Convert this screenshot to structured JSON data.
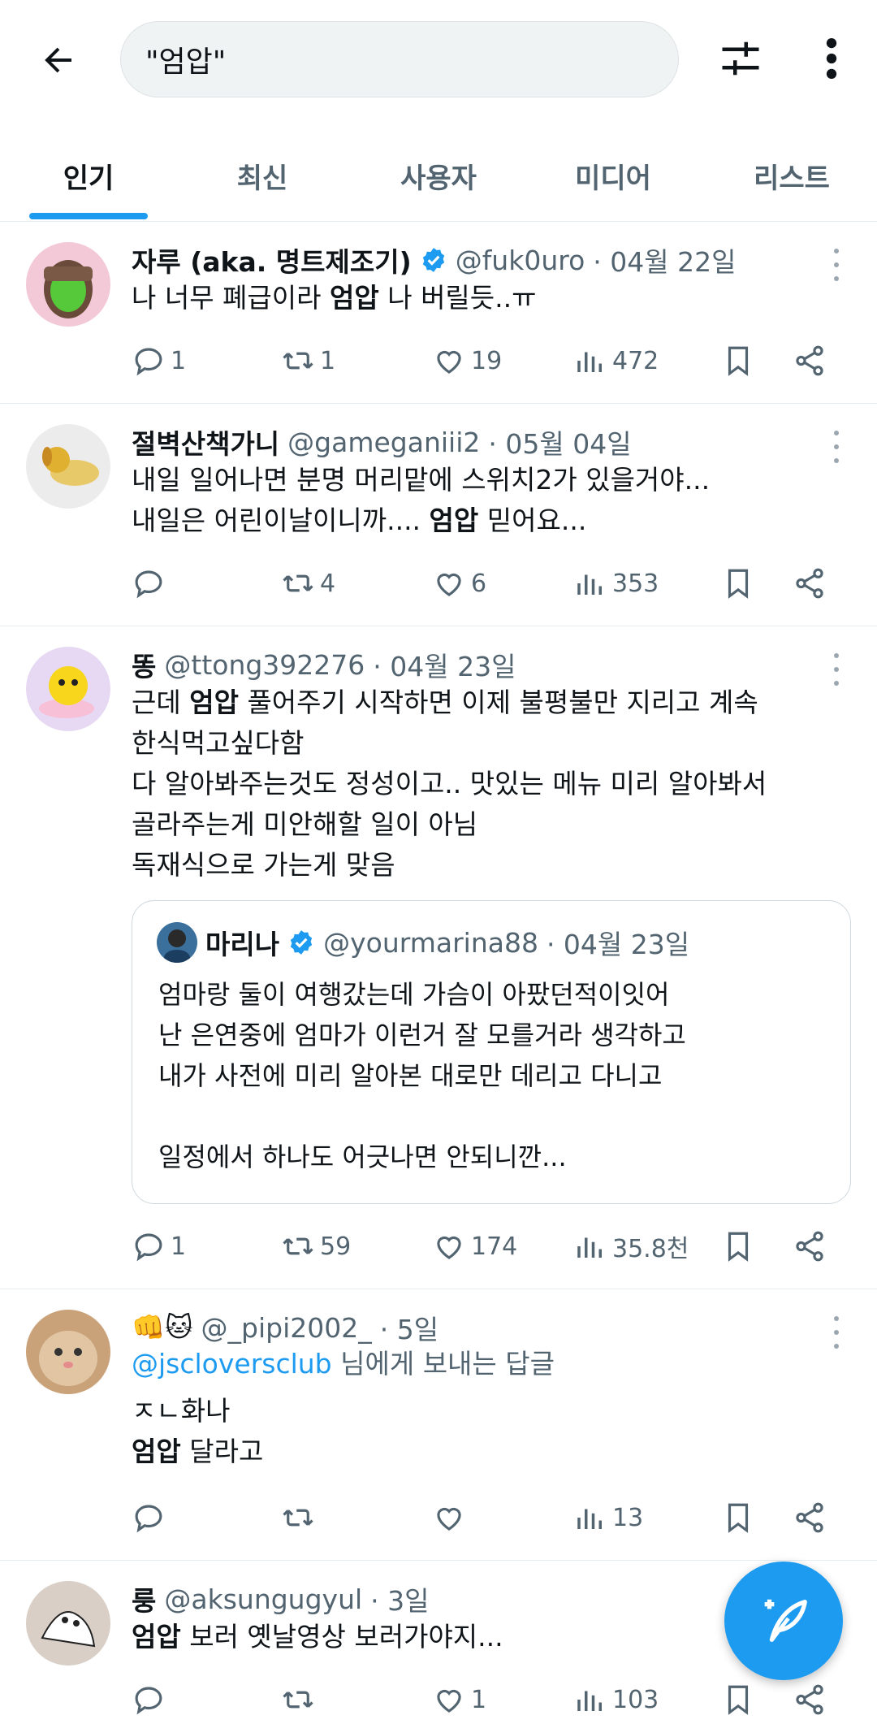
{
  "search": {
    "query": "\"엄압\""
  },
  "tabs": [
    "인기",
    "최신",
    "사용자",
    "미디어",
    "리스트"
  ],
  "colors": {
    "accent": "#1d9bf0",
    "text": "#0f1419",
    "muted": "#536471"
  },
  "tweets": [
    {
      "name": "자루 (aka. 명트제조기)",
      "handle": "@fuk0uro",
      "time": "· 04월 22일",
      "verified": true,
      "lines": [
        [
          "나 너무 폐급이라 ",
          "엄압",
          " 나 버릴듯..ㅠ"
        ]
      ],
      "stats": {
        "reply": "1",
        "retweet": "1",
        "like": "19",
        "views": "472"
      }
    },
    {
      "name": "절벽산책가니",
      "handle": "@gameganiii2",
      "time": "· 05월 04일",
      "lines": [
        [
          "내일 일어나면 분명 머리맡에 스위치2가 있을거야...",
          "",
          ""
        ],
        [
          "내일은 어린이날이니까.... ",
          "엄압",
          " 믿어요..."
        ]
      ],
      "stats": {
        "reply": "",
        "retweet": "4",
        "like": "6",
        "views": "353"
      }
    },
    {
      "name": "똥",
      "handle": "@ttong392276",
      "time": "· 04월 23일",
      "lines": [
        [
          "근데 ",
          "엄압",
          " 풀어주기 시작하면 이제 불평불만 지리고 계속"
        ],
        [
          "한식먹고싶다함",
          "",
          ""
        ],
        [
          "다 알아봐주는것도 정성이고.. 맛있는 메뉴 미리 알아봐서",
          "",
          ""
        ],
        [
          "골라주는게 미안해할 일이 아님",
          "",
          ""
        ],
        [
          "독재식으로 가는게 맞음",
          "",
          ""
        ]
      ],
      "quote": {
        "name": "마리나",
        "handle": "@yourmarina88",
        "time": "· 04월 23일",
        "verified": true,
        "lines": [
          "엄마랑 둘이 여행갔는데 가슴이 아팠던적이잇어",
          "난 은연중에 엄마가 이런거 잘 모를거라 생각하고",
          "내가 사전에 미리 알아본 대로만 데리고 다니고",
          "",
          "일정에서 하나도 어긋나면 안되니깐..."
        ]
      },
      "stats": {
        "reply": "1",
        "retweet": "59",
        "like": "174",
        "views": "35.8천"
      }
    },
    {
      "name": "👊🐱",
      "handle": "@_pipi2002_",
      "time": "· 5일",
      "reply_to": {
        "handle": "@jscloversclub",
        "suffix": " 님에게 보내는 답글"
      },
      "lines": [
        [
          "ㅈㄴ화나",
          "",
          ""
        ],
        [
          "",
          "엄압",
          " 달라고"
        ]
      ],
      "stats": {
        "reply": "",
        "retweet": "",
        "like": "",
        "views": "13"
      }
    },
    {
      "name": "룽",
      "handle": "@aksungugyul",
      "time": "· 3일",
      "lines": [
        [
          "",
          "엄압",
          " 보러 옛날영상 보러가야지..."
        ]
      ],
      "stats": {
        "reply": "",
        "retweet": "",
        "like": "1",
        "views": "103"
      }
    }
  ]
}
